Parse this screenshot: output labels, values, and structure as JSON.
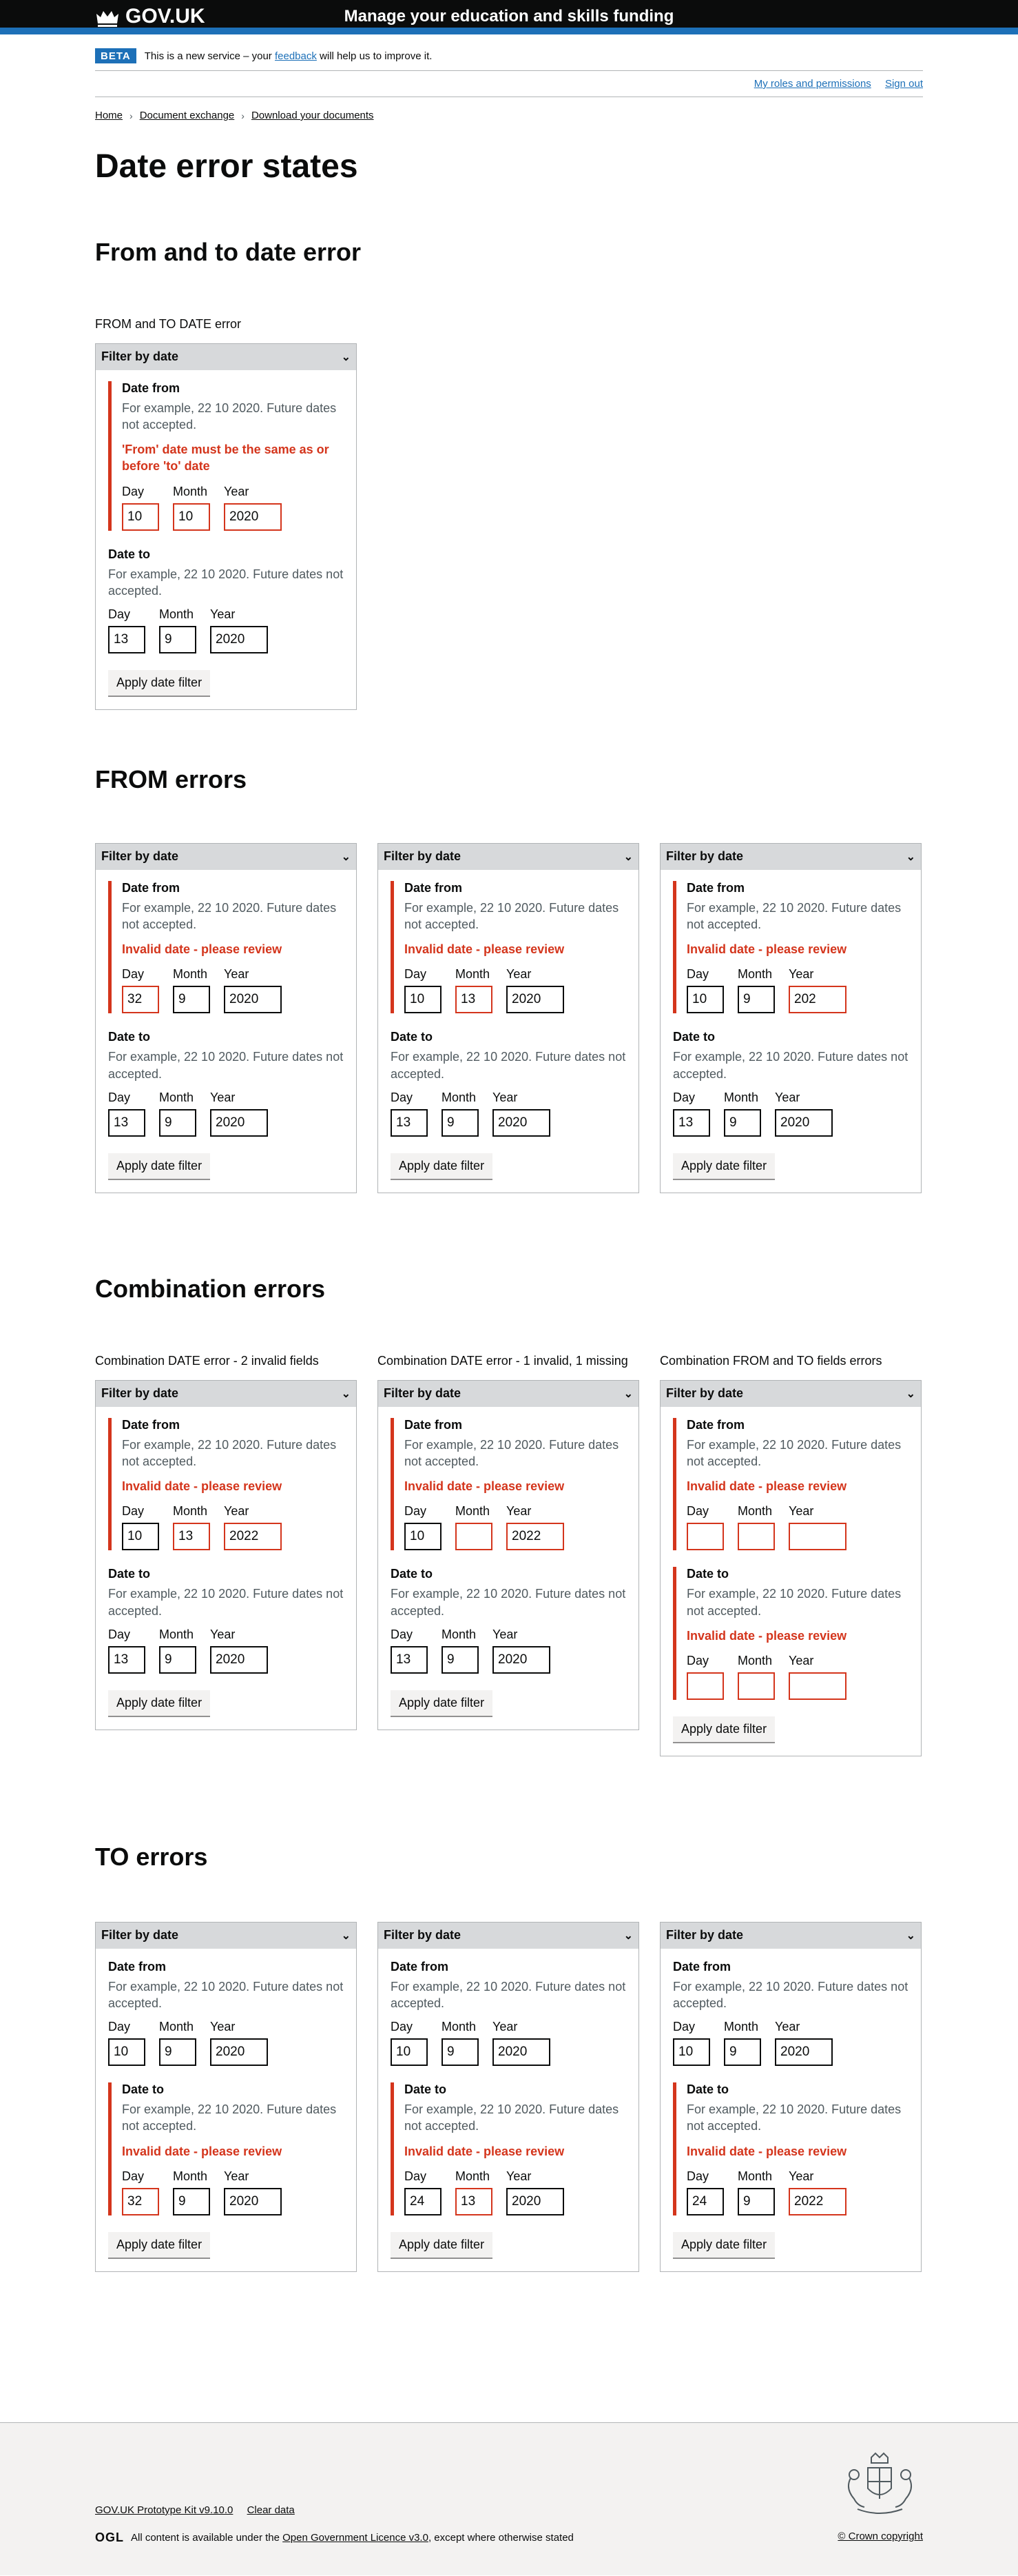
{
  "header": {
    "logo_text": "GOV.UK",
    "service_name": "Manage your education and skills funding"
  },
  "phase": {
    "tag": "BETA",
    "text_before": "This is a new service – your ",
    "link": "feedback",
    "text_after": " will help us to improve it."
  },
  "account_nav": {
    "roles": "My roles and permissions",
    "sign_out": "Sign out"
  },
  "breadcrumbs": [
    "Home",
    "Document exchange",
    "Download your documents"
  ],
  "page_title": "Date error states",
  "common": {
    "filter_title": "Filter by date",
    "date_from": "Date from",
    "date_to": "Date to",
    "hint": "For example, 22 10 2020. Future dates not accepted.",
    "day": "Day",
    "month": "Month",
    "year": "Year",
    "apply": "Apply date filter",
    "invalid": "Invalid date - please review",
    "order_error": "'From' date must be the same as or before 'to' date"
  },
  "sections": {
    "s1": {
      "heading": "From and to date error",
      "captions": [
        "FROM and TO DATE error"
      ],
      "panels": [
        {
          "from": [
            "10",
            "10",
            "2020"
          ],
          "to": [
            "13",
            "9",
            "2020"
          ]
        }
      ]
    },
    "s2": {
      "heading": "FROM errors",
      "panels": [
        {
          "from": [
            "32",
            "9",
            "2020"
          ],
          "to": [
            "13",
            "9",
            "2020"
          ]
        },
        {
          "from": [
            "10",
            "13",
            "2020"
          ],
          "to": [
            "13",
            "9",
            "2020"
          ]
        },
        {
          "from": [
            "10",
            "9",
            "202"
          ],
          "to": [
            "13",
            "9",
            "2020"
          ]
        }
      ]
    },
    "s3": {
      "heading": "Combination errors",
      "captions": [
        "Combination DATE error - 2 invalid fields",
        "Combination DATE error - 1 invalid, 1 missing",
        "Combination FROM and TO fields errors"
      ],
      "panels": [
        {
          "from": [
            "10",
            "13",
            "2022"
          ],
          "to": [
            "13",
            "9",
            "2020"
          ]
        },
        {
          "from": [
            "10",
            "",
            "2022"
          ],
          "to": [
            "13",
            "9",
            "2020"
          ]
        },
        {
          "from": [
            "",
            "",
            ""
          ],
          "to": [
            "",
            "",
            ""
          ]
        }
      ]
    },
    "s4": {
      "heading": "TO errors",
      "panels": [
        {
          "from": [
            "10",
            "9",
            "2020"
          ],
          "to": [
            "32",
            "9",
            "2020"
          ]
        },
        {
          "from": [
            "10",
            "9",
            "2020"
          ],
          "to": [
            "24",
            "13",
            "2020"
          ]
        },
        {
          "from": [
            "10",
            "9",
            "2020"
          ],
          "to": [
            "24",
            "9",
            "2022"
          ]
        }
      ]
    }
  },
  "footer": {
    "links": [
      "GOV.UK Prototype Kit v9.10.0",
      "Clear data"
    ],
    "ogl": "OGL",
    "licence_before": "All content is available under the ",
    "licence_link": "Open Government Licence v3.0",
    "licence_after": ", except where otherwise stated",
    "copyright": "© Crown copyright"
  }
}
